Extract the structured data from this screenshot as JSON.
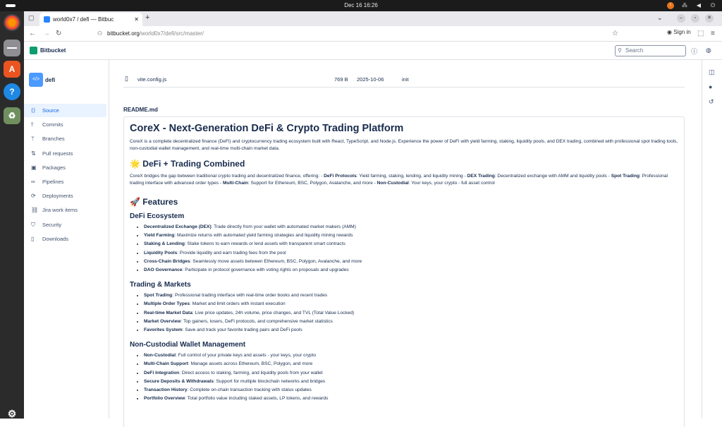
{
  "system": {
    "clock": "Dec 16  16:26"
  },
  "browser": {
    "tab_title": "world0x7 / defi — Bitbuc",
    "url_host": "bitbucket.org",
    "url_path": "/world0x7/defi/src/master/",
    "signin_label": "Sign in"
  },
  "header": {
    "product": "Bitbucket",
    "search_placeholder": "Search"
  },
  "sidebar": {
    "repo_icon_label": "</>",
    "repo_name": "defi",
    "items": [
      {
        "label": "Source",
        "icon": "code-icon"
      },
      {
        "label": "Commits",
        "icon": "commit-icon"
      },
      {
        "label": "Branches",
        "icon": "branch-icon"
      },
      {
        "label": "Pull requests",
        "icon": "pull-request-icon"
      },
      {
        "label": "Packages",
        "icon": "package-icon"
      },
      {
        "label": "Pipelines",
        "icon": "pipeline-icon"
      },
      {
        "label": "Deployments",
        "icon": "deploy-icon"
      },
      {
        "label": "Jira work items",
        "icon": "link-icon"
      },
      {
        "label": "Security",
        "icon": "shield-icon"
      },
      {
        "label": "Downloads",
        "icon": "file-icon"
      }
    ]
  },
  "file_row": {
    "name": "vite.config.js",
    "size": "769 B",
    "date": "2025-10-06",
    "message": "init"
  },
  "readme": {
    "label": "README.md",
    "title": "CoreX - Next-Generation DeFi & Crypto Trading Platform",
    "intro": "CoreX is a complete decentralized finance (DeFi) and cryptocurrency trading ecosystem built with React, TypeScript, and Node.js. Experience the power of DeFi with yield farming, staking, liquidity pools, and DEX trading, combined with professional spot trading tools, non-custodial wallet management, and real-time multi-chain market data.",
    "combined_heading": "🌟 DeFi + Trading Combined",
    "combined": {
      "lead": "CoreX bridges the gap between traditional crypto trading and decentralized finance, offering: - ",
      "parts": [
        {
          "b": "DeFi Protocols",
          "t": ": Yield farming, staking, lending, and liquidity mining - "
        },
        {
          "b": "DEX Trading",
          "t": ": Decentralized exchange with AMM and liquidity pools - "
        },
        {
          "b": "Spot Trading",
          "t": ": Professional trading interface with advanced order types - "
        },
        {
          "b": "Multi-Chain",
          "t": ": Support for Ethereum, BSC, Polygon, Avalanche, and more - "
        },
        {
          "b": "Non-Custodial",
          "t": ": Your keys, your crypto - full asset control"
        }
      ]
    },
    "features_heading": "🚀 Features",
    "sections": [
      {
        "heading": "DeFi Ecosystem",
        "items": [
          {
            "b": "Decentralized Exchange (DEX)",
            "t": ": Trade directly from your wallet with automated market makers (AMM)"
          },
          {
            "b": "Yield Farming",
            "t": ": Maximize returns with automated yield farming strategies and liquidity mining rewards"
          },
          {
            "b": "Staking & Lending",
            "t": ": Stake tokens to earn rewards or lend assets with transparent smart contracts"
          },
          {
            "b": "Liquidity Pools",
            "t": ": Provide liquidity and earn trading fees from the pool"
          },
          {
            "b": "Cross-Chain Bridges",
            "t": ": Seamlessly move assets between Ethereum, BSC, Polygon, Avalanche, and more"
          },
          {
            "b": "DAO Governance",
            "t": ": Participate in protocol governance with voting rights on proposals and upgrades"
          }
        ]
      },
      {
        "heading": "Trading & Markets",
        "items": [
          {
            "b": "Spot Trading",
            "t": ": Professional trading interface with real-time order books and recent trades"
          },
          {
            "b": "Multiple Order Types",
            "t": ": Market and limit orders with instant execution"
          },
          {
            "b": "Real-time Market Data",
            "t": ": Live price updates, 24h volume, price changes, and TVL (Total Value Locked)"
          },
          {
            "b": "Market Overview",
            "t": ": Top gainers, losers, DeFi protocols, and comprehensive market statistics"
          },
          {
            "b": "Favorites System",
            "t": ": Save and track your favorite trading pairs and DeFi pools"
          }
        ]
      },
      {
        "heading": "Non-Custodial Wallet Management",
        "items": [
          {
            "b": "Non-Custodial",
            "t": ": Full control of your private keys and assets - your keys, your crypto"
          },
          {
            "b": "Multi-Chain Support",
            "t": ": Manage assets across Ethereum, BSC, Polygon, and more"
          },
          {
            "b": "DeFi Integration",
            "t": ": Direct access to staking, farming, and liquidity pools from your wallet"
          },
          {
            "b": "Secure Deposits & Withdrawals",
            "t": ": Support for multiple blockchain networks and bridges"
          },
          {
            "b": "Transaction History",
            "t": ": Complete on-chain transaction tracking with status updates"
          },
          {
            "b": "Portfolio Overview",
            "t": ": Total portfolio value including staked assets, LP tokens, and rewards"
          }
        ]
      }
    ]
  }
}
